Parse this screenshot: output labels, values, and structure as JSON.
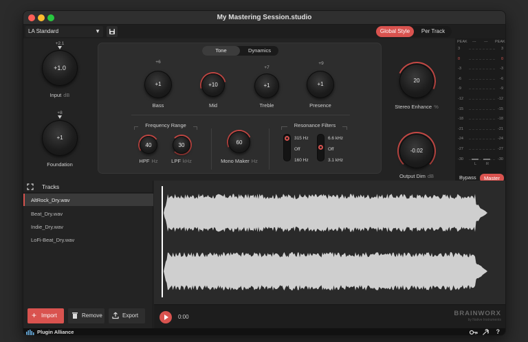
{
  "window": {
    "title": "My Mastering Session.studio"
  },
  "toolbar": {
    "preset": "LA Standard",
    "mode_tabs": [
      {
        "label": "Global Style",
        "active": true
      },
      {
        "label": "Per Track",
        "active": false
      }
    ]
  },
  "knobs": {
    "input": {
      "value": "+1.0",
      "top": "+2.1",
      "label": "Input",
      "unit": "dB"
    },
    "foundation": {
      "value": "+1",
      "top": "+8",
      "label": "Foundation"
    },
    "stereo": {
      "value": "20",
      "label": "Stereo Enhance",
      "unit": "%"
    },
    "output": {
      "value": "-0.02",
      "label": "Output Dim",
      "unit": "dB"
    }
  },
  "center": {
    "tabs": [
      {
        "label": "Tone",
        "active": true
      },
      {
        "label": "Dynamics",
        "active": false
      }
    ],
    "eq": [
      {
        "label": "Bass",
        "value": "+1",
        "top": "+6"
      },
      {
        "label": "Mid",
        "value": "+10",
        "top": ""
      },
      {
        "label": "Treble",
        "value": "+1",
        "top": "+7"
      },
      {
        "label": "Presence",
        "value": "+1",
        "top": "+9"
      }
    ],
    "freq_range": {
      "title": "Frequency Range",
      "hpf": {
        "value": "40",
        "label": "HPF",
        "unit": "Hz"
      },
      "lpf": {
        "value": "30",
        "label": "LPF",
        "unit": "kHz"
      }
    },
    "mono": {
      "value": "60",
      "label": "Mono Maker",
      "unit": "Hz"
    },
    "resonance": {
      "title": "Resonance Filters",
      "left": [
        "315 Hz",
        "Off",
        "160 Hz"
      ],
      "right": [
        "6.6 kHz",
        "Off",
        "3.1 kHz"
      ]
    }
  },
  "meters": {
    "peak_l": "PEAK",
    "peak_r": "PEAK",
    "top_l": "---",
    "top_r": "---",
    "scale": [
      "3",
      "0",
      "-3",
      "-6",
      "-9",
      "-12",
      "-15",
      "-18",
      "-21",
      "-24",
      "-27",
      "-30"
    ],
    "zero_color": "#e05a55",
    "lr": [
      "L",
      "R"
    ],
    "bypass": "Bypass",
    "master": "Master"
  },
  "tracks": {
    "title": "Tracks",
    "items": [
      "AltRock_Dry.wav",
      "Beat_Dry.wav",
      "Indie_Dry.wav",
      "LoFi-Beat_Dry.wav"
    ],
    "selected": 0,
    "import": "Import",
    "remove": "Remove",
    "export": "Export"
  },
  "transport": {
    "time": "0:00",
    "brand": "BRAINWORX",
    "brand_sub": "by Native Instruments"
  },
  "status": {
    "brand": "Plugin Alliance",
    "help": "?"
  },
  "colors": {
    "accent": "#d9534f"
  }
}
